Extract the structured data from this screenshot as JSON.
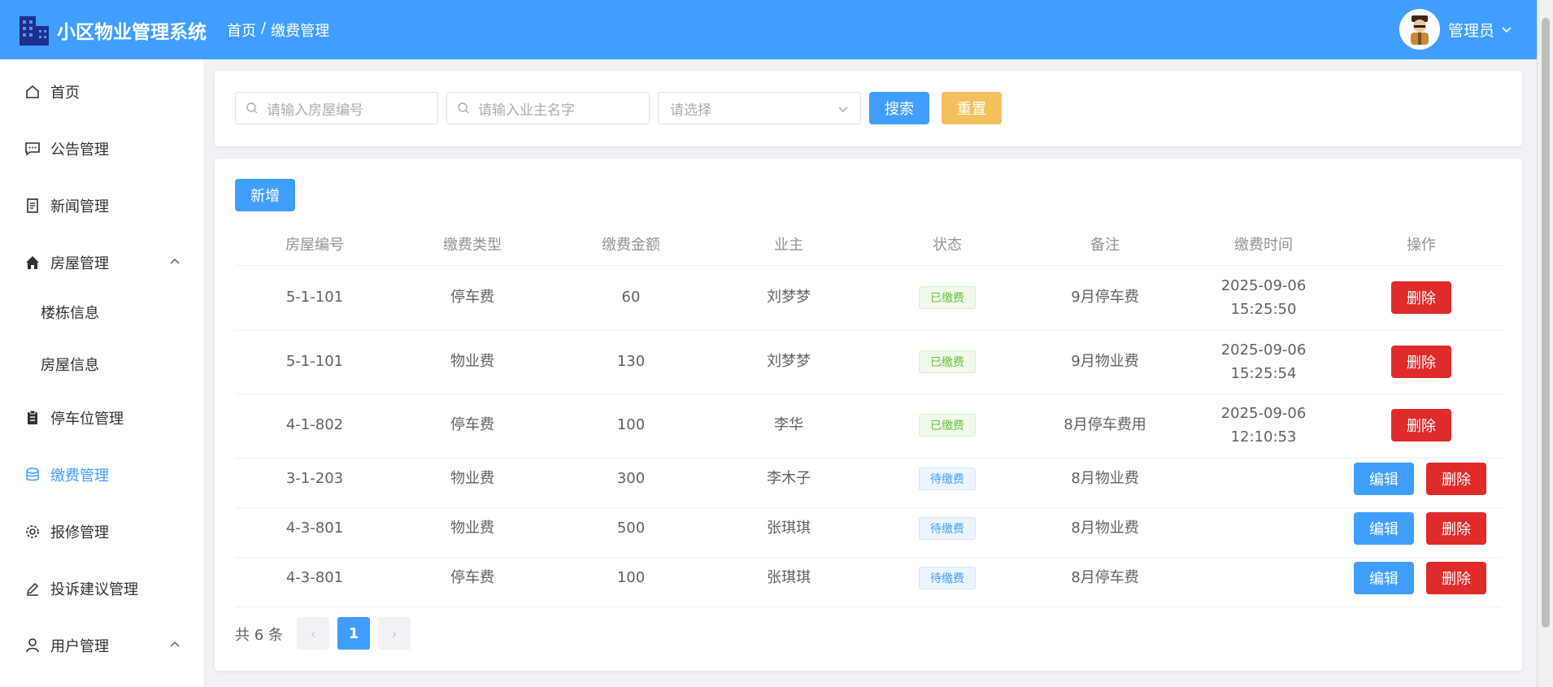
{
  "header": {
    "app_title": "小区物业管理系统",
    "breadcrumb": [
      "首页",
      "/",
      "缴费管理"
    ],
    "user_name": "管理员"
  },
  "sidebar": {
    "items": [
      {
        "label": "首页",
        "icon": "home-icon"
      },
      {
        "label": "公告管理",
        "icon": "chat-icon"
      },
      {
        "label": "新闻管理",
        "icon": "document-icon"
      },
      {
        "label": "房屋管理",
        "icon": "house-icon"
      },
      {
        "label": "楼栋信息"
      },
      {
        "label": "房屋信息"
      },
      {
        "label": "停车位管理",
        "icon": "clipboard-icon"
      },
      {
        "label": "缴费管理",
        "icon": "coins-icon"
      },
      {
        "label": "报修管理",
        "icon": "gear-icon"
      },
      {
        "label": "投诉建议管理",
        "icon": "pen-icon"
      },
      {
        "label": "用户管理",
        "icon": "user-icon"
      }
    ]
  },
  "search": {
    "house_placeholder": "请输入房屋编号",
    "owner_placeholder": "请输入业主名字",
    "select_placeholder": "请选择",
    "search_label": "搜索",
    "reset_label": "重置"
  },
  "toolbar": {
    "add_label": "新增"
  },
  "table": {
    "columns": [
      "房屋编号",
      "缴费类型",
      "缴费金额",
      "业主",
      "状态",
      "备注",
      "缴费时间",
      "操作"
    ],
    "rows": [
      {
        "house": "5-1-101",
        "type": "停车费",
        "amount": "60",
        "owner": "刘梦梦",
        "status": "已缴费",
        "note": "9月停车费",
        "date": "2025-09-06",
        "time": "15:25:50"
      },
      {
        "house": "5-1-101",
        "type": "物业费",
        "amount": "130",
        "owner": "刘梦梦",
        "status": "已缴费",
        "note": "9月物业费",
        "date": "2025-09-06",
        "time": "15:25:54"
      },
      {
        "house": "4-1-802",
        "type": "停车费",
        "amount": "100",
        "owner": "李华",
        "status": "已缴费",
        "note": "8月停车费用",
        "date": "2025-09-06",
        "time": "12:10:53"
      },
      {
        "house": "3-1-203",
        "type": "物业费",
        "amount": "300",
        "owner": "李木子",
        "status": "待缴费",
        "note": "8月物业费",
        "date": "",
        "time": ""
      },
      {
        "house": "4-3-801",
        "type": "物业费",
        "amount": "500",
        "owner": "张琪琪",
        "status": "待缴费",
        "note": "8月物业费",
        "date": "",
        "time": ""
      },
      {
        "house": "4-3-801",
        "type": "停车费",
        "amount": "100",
        "owner": "张琪琪",
        "status": "待缴费",
        "note": "8月停车费",
        "date": "",
        "time": ""
      }
    ],
    "edit_label": "编辑",
    "delete_label": "删除"
  },
  "pagination": {
    "total": "共 6 条",
    "prev": "‹",
    "current": "1",
    "next": "›"
  },
  "colors": {
    "primary": "#409eff",
    "warning": "#f3c05e",
    "danger": "#e02b2b",
    "success": "#67c23a"
  }
}
